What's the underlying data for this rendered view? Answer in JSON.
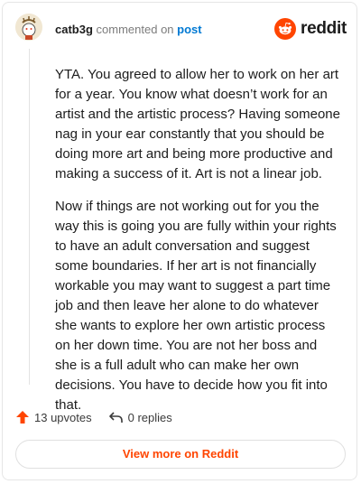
{
  "header": {
    "username": "catb3g",
    "commented_text": "commented on",
    "post_link_label": "post",
    "logo_text": "reddit"
  },
  "comment": {
    "paragraphs": [
      "YTA. You agreed to allow her to work on her art for a year. You know what doesn’t work for an artist and the artistic process? Having someone nag in your ear constantly that you should be doing more art and being more productive and making a success of it. Art is not a linear job.",
      "Now if things are not working out for you the way this is going you are fully within your rights to have an adult conversation and suggest some boundaries. If her art is not financially workable you may want to suggest a part time job and then leave her alone to do whatever she wants to explore her own artistic process on her down time. You are not her boss and she is a full adult who can make her own decisions. You have to decide how you fit into that."
    ]
  },
  "footer": {
    "upvotes_label": "13 upvotes",
    "replies_label": "0 replies",
    "view_more_label": "View more on Reddit"
  },
  "colors": {
    "accent": "#ff4500",
    "link": "#0079d3"
  },
  "icons": {
    "upvote": "upvote-arrow-icon",
    "reply": "reply-arrow-icon",
    "logo": "reddit-logo-icon",
    "avatar": "avatar"
  }
}
